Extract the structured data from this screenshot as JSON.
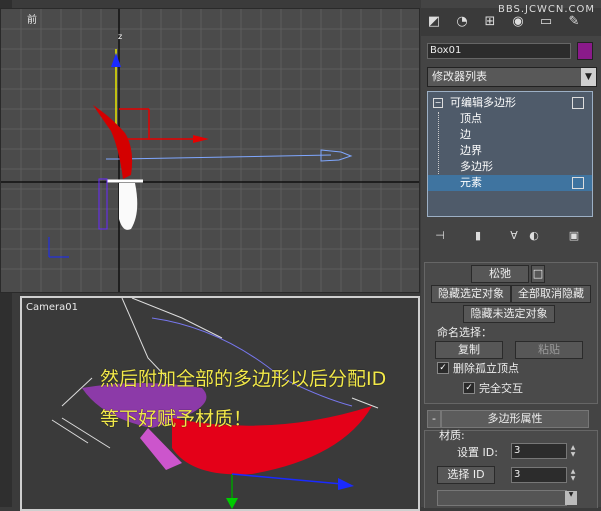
{
  "viewports": {
    "front": {
      "label": "前"
    },
    "camera": {
      "label": "Camera01"
    }
  },
  "overlay": {
    "line1": "然后附加全部的多边形以后分配ID",
    "line2": "等下好赋予材质！"
  },
  "panel": {
    "watermark": "BBS.JCWCN.COM",
    "object_name": "Box01",
    "object_color": "#8a1a8a",
    "modifier_list": "修改器列表",
    "stack": {
      "root": "可编辑多边形",
      "items": [
        "顶点",
        "边",
        "边界",
        "多边形",
        "元素"
      ],
      "selected": "元素"
    },
    "relax": "松弛",
    "hide_selected": "隐藏选定对象",
    "unhide_all": "全部取消隐藏",
    "hide_unselected": "隐藏未选定对象",
    "named_selection": "命名选择：",
    "copy": "复制",
    "paste": "粘贴",
    "delete_isolated": "删除孤立顶点",
    "full_interactivity": "完全交互",
    "poly_props_minus": "-",
    "poly_props": "多边形属性",
    "material": "材质:",
    "set_id_label": "设置 ID:",
    "set_id_value": "3",
    "select_id_btn": "选择 ID",
    "select_id_value": "3"
  }
}
